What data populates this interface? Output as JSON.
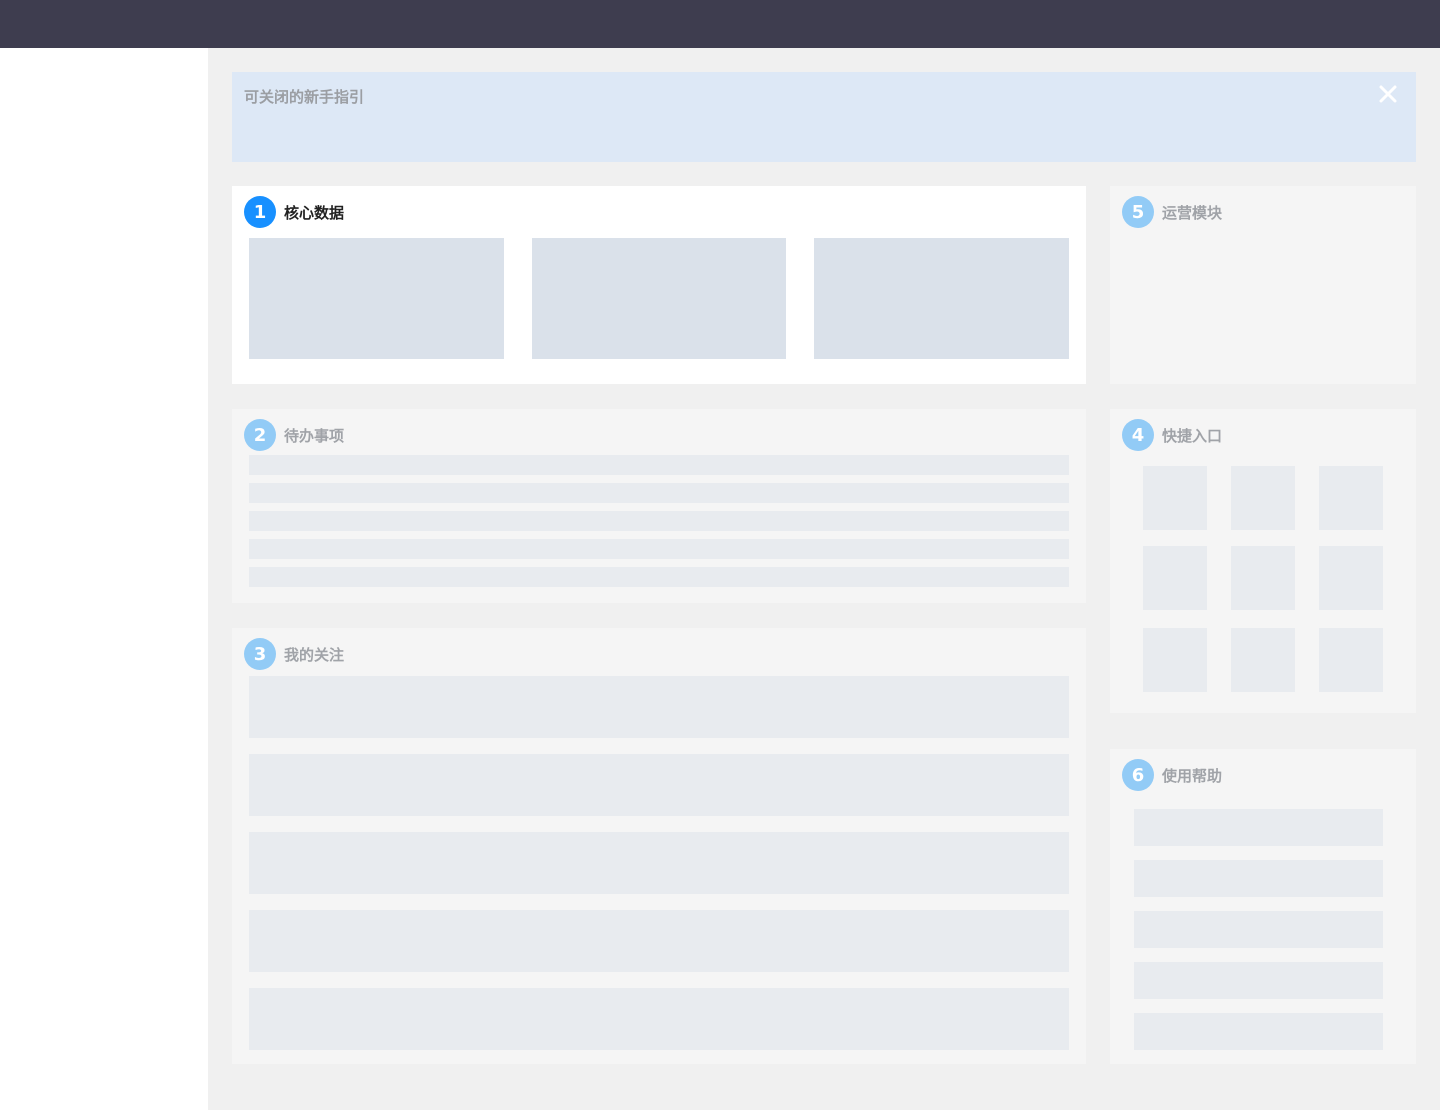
{
  "guide": {
    "title": "可关闭的新手指引"
  },
  "modules": {
    "core": {
      "number": "1",
      "title": "核心数据"
    },
    "todo": {
      "number": "2",
      "title": "待办事项"
    },
    "follow": {
      "number": "3",
      "title": "我的关注"
    },
    "shortcuts": {
      "number": "4",
      "title": "快捷入口"
    },
    "ops": {
      "number": "5",
      "title": "运营模块"
    },
    "help": {
      "number": "6",
      "title": "使用帮助"
    }
  },
  "colors": {
    "topbar": "#3e3d4f",
    "canvas": "#f0f0f0",
    "guide_bg": "#dde8f6",
    "active_badge": "#1890ff",
    "inactive_badge": "#92cbf6",
    "placeholder": "#e8ebef"
  },
  "icons": {
    "guide_close": "close-icon"
  }
}
